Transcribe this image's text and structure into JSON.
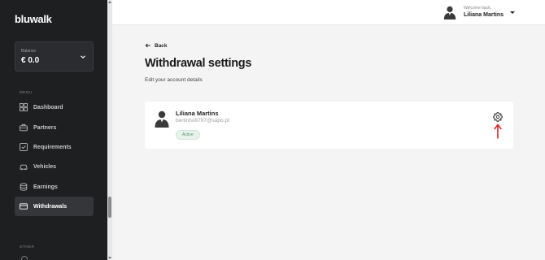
{
  "app": {
    "logo": "bluwalk"
  },
  "balance": {
    "label": "Balance",
    "currency": "€",
    "amount": "0.0",
    "chevron_icon": "chevron-down-icon"
  },
  "menu": {
    "heading": "MENU",
    "items": [
      {
        "label": "Dashboard",
        "icon": "grid-icon",
        "active": false
      },
      {
        "label": "Partners",
        "icon": "briefcase-icon",
        "active": false
      },
      {
        "label": "Requirements",
        "icon": "checklist-icon",
        "active": false
      },
      {
        "label": "Vehicles",
        "icon": "car-icon",
        "active": false
      },
      {
        "label": "Earnings",
        "icon": "coins-icon",
        "active": false
      },
      {
        "label": "Withdrawals",
        "icon": "card-icon",
        "active": true
      }
    ]
  },
  "other": {
    "heading": "OTHER"
  },
  "header": {
    "welcome": "Welcome back,",
    "user_name": "Liliana Martins"
  },
  "page": {
    "back_label": "Back",
    "title": "Withdrawal settings",
    "subtitle": "Edit your account details"
  },
  "account": {
    "name": "Liliana Martins",
    "email": "bertinho8787@sapo.pt",
    "status": "Active",
    "status_color": "#5b8f6c"
  },
  "colors": {
    "sidebar": "#1e1f21",
    "annotation_arrow": "#d6262c"
  }
}
